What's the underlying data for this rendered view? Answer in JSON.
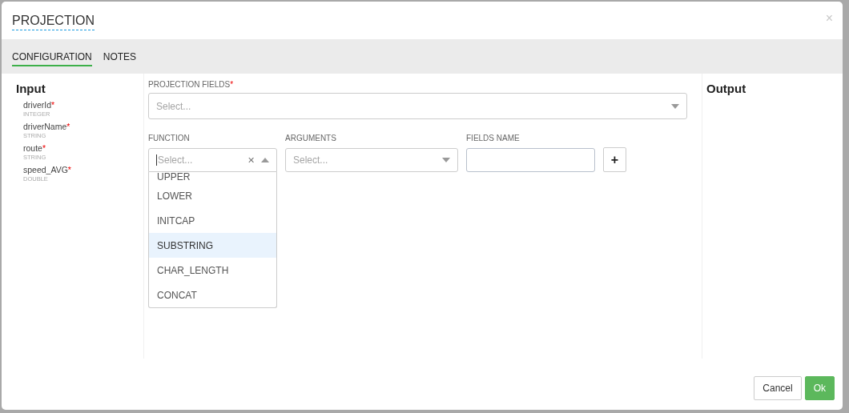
{
  "dialog": {
    "title": "PROJECTION",
    "close": "×"
  },
  "tabs": [
    {
      "label": "CONFIGURATION",
      "selected": true
    },
    {
      "label": "NOTES",
      "selected": false
    }
  ],
  "input": {
    "title": "Input",
    "fields": [
      {
        "name": "driverId",
        "required_mark": "*",
        "type": "INTEGER"
      },
      {
        "name": "driverName",
        "required_mark": "*",
        "type": "STRING"
      },
      {
        "name": "route",
        "required_mark": "*",
        "type": "STRING"
      },
      {
        "name": "speed_AVG",
        "required_mark": "*",
        "type": "DOUBLE"
      }
    ]
  },
  "projection_fields": {
    "label": "PROJECTION FIELDS",
    "required_mark": "*",
    "placeholder": "Select..."
  },
  "function": {
    "label": "FUNCTION",
    "placeholder": "Select...",
    "clear": "✕",
    "expanded": true,
    "options": [
      {
        "label": "UPPER",
        "selected": false
      },
      {
        "label": "LOWER",
        "selected": false
      },
      {
        "label": "INITCAP",
        "selected": false
      },
      {
        "label": "SUBSTRING",
        "selected": true
      },
      {
        "label": "CHAR_LENGTH",
        "selected": false
      },
      {
        "label": "CONCAT",
        "selected": false
      }
    ]
  },
  "arguments": {
    "label": "ARGUMENTS",
    "placeholder": "Select..."
  },
  "fields_name": {
    "label": "FIELDS NAME"
  },
  "add_button": "+",
  "output": {
    "title": "Output"
  },
  "buttons": [
    {
      "label": "Cancel",
      "kind": "secondary"
    },
    {
      "label": "Ok",
      "kind": "primary"
    }
  ]
}
